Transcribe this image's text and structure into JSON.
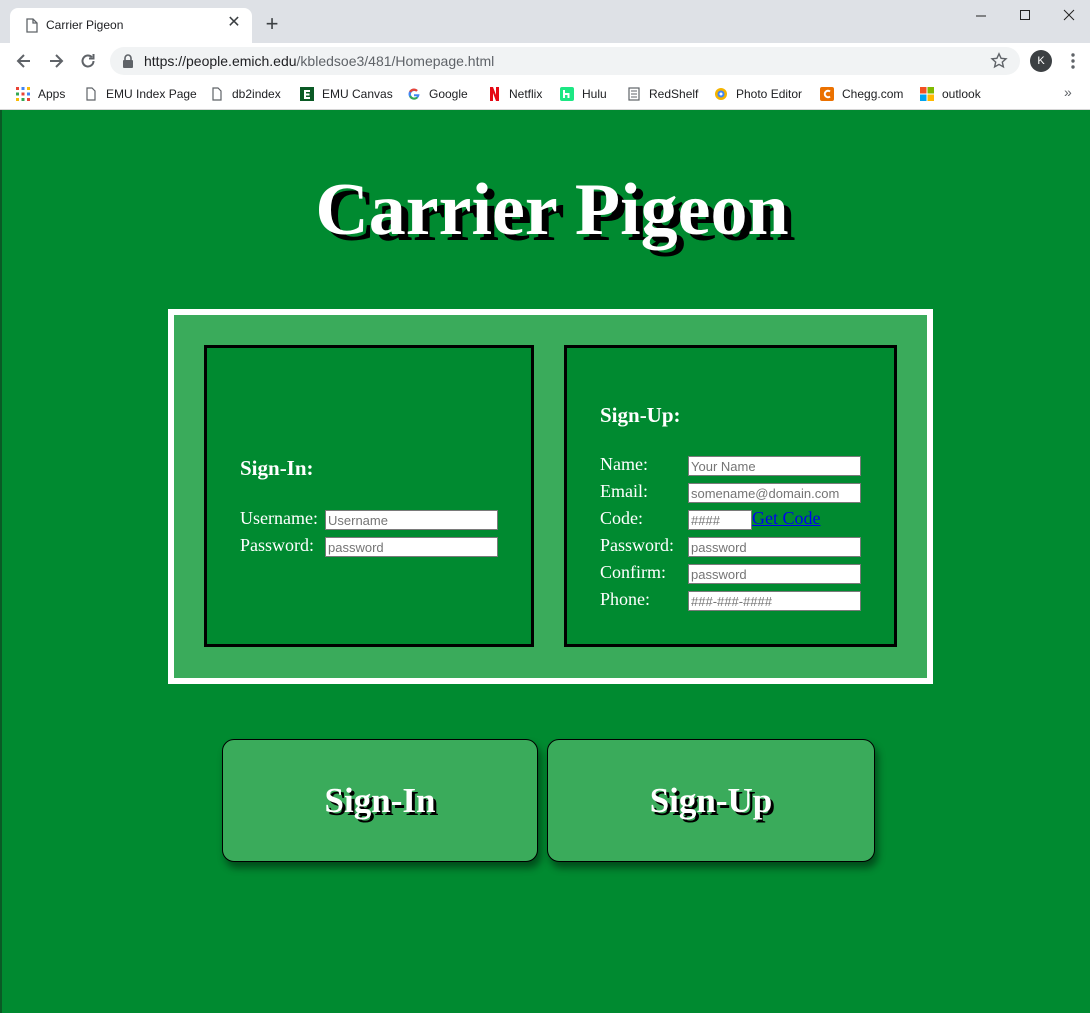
{
  "browser": {
    "tab_title": "Carrier Pigeon",
    "tab_close": "✕",
    "new_tab": "+",
    "url_host": "https://people.emich.edu",
    "url_path": "/kbledsoe3/481/Homepage.html",
    "profile_initial": "K",
    "bookmarks": [
      {
        "label": "Apps",
        "icon": "apps-grid-icon"
      },
      {
        "label": "EMU Index Page",
        "icon": "document-icon"
      },
      {
        "label": "db2index",
        "icon": "document-icon"
      },
      {
        "label": "EMU Canvas",
        "icon": "emu-logo-icon"
      },
      {
        "label": "Google",
        "icon": "google-icon"
      },
      {
        "label": "Netflix",
        "icon": "netflix-icon"
      },
      {
        "label": "Hulu",
        "icon": "hulu-icon"
      },
      {
        "label": "RedShelf",
        "icon": "redshelf-icon"
      },
      {
        "label": "Photo Editor",
        "icon": "photo-editor-icon"
      },
      {
        "label": "Chegg.com",
        "icon": "chegg-icon"
      },
      {
        "label": "outlook",
        "icon": "windows-logo-icon"
      }
    ],
    "bookmarks_more": "»"
  },
  "page": {
    "title": "Carrier Pigeon",
    "signin": {
      "heading": "Sign-In:",
      "username_label": "Username:",
      "username_placeholder": "Username",
      "password_label": "Password:",
      "password_placeholder": "password"
    },
    "signup": {
      "heading": "Sign-Up:",
      "name_label": "Name:",
      "name_placeholder": "Your Name",
      "email_label": "Email:",
      "email_placeholder": "somename@domain.com",
      "code_label": "Code:",
      "code_placeholder": "####",
      "get_code_link": "Get Code",
      "password_label": "Password:",
      "password_placeholder": "password",
      "confirm_label": "Confirm:",
      "confirm_placeholder": "password",
      "phone_label": "Phone:",
      "phone_placeholder": "###-###-####"
    },
    "buttons": {
      "signin": "Sign-In",
      "signup": "Sign-Up"
    }
  },
  "colors": {
    "page_bg": "#008a30",
    "panel_bg": "#3aab5b",
    "tabstrip_bg": "#dee1e6"
  }
}
